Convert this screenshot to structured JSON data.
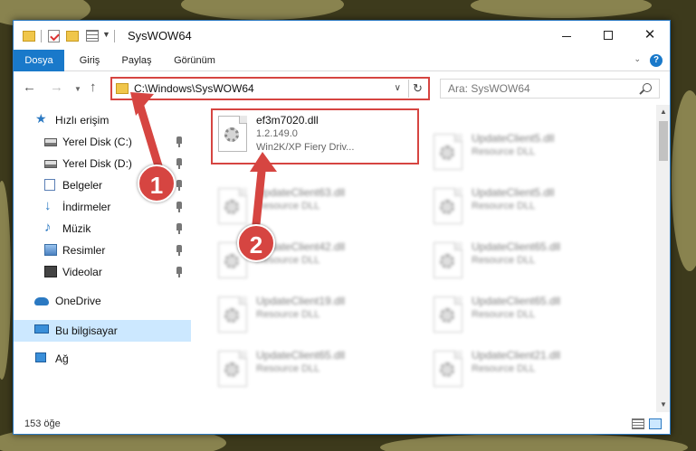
{
  "window": {
    "title": "SysWOW64"
  },
  "ribbon": {
    "tabs": [
      "Dosya",
      "Giriş",
      "Paylaş",
      "Görünüm"
    ]
  },
  "address": {
    "path": "C:\\Windows\\SysWOW64",
    "search_placeholder": "Ara: SysWOW64"
  },
  "nav": {
    "items": [
      {
        "label": "Hızlı erişim",
        "icon": "star-icon",
        "pinned": false
      },
      {
        "label": "Yerel Disk (C:)",
        "icon": "drive-icon",
        "pinned": true
      },
      {
        "label": "Yerel Disk (D:)",
        "icon": "drive-icon",
        "pinned": true
      },
      {
        "label": "Belgeler",
        "icon": "document-icon",
        "pinned": true
      },
      {
        "label": "İndirmeler",
        "icon": "download-icon",
        "pinned": true
      },
      {
        "label": "Müzik",
        "icon": "music-icon",
        "pinned": true
      },
      {
        "label": "Resimler",
        "icon": "pictures-icon",
        "pinned": true
      },
      {
        "label": "Videolar",
        "icon": "videos-icon",
        "pinned": true
      },
      {
        "label": "OneDrive",
        "icon": "cloud-icon",
        "pinned": false
      },
      {
        "label": "Bu bilgisayar",
        "icon": "computer-icon",
        "pinned": false,
        "selected": true
      },
      {
        "label": "Ağ",
        "icon": "network-icon",
        "pinned": false
      }
    ]
  },
  "files": {
    "main": {
      "name": "ef3m7020.dll",
      "version": "1.2.149.0",
      "description": "Win2K/XP Fiery Driv..."
    },
    "left_column": [
      {
        "name": "UpdateClient63.dll",
        "type": "Resource DLL"
      },
      {
        "name": "UpdateClient42.dll",
        "type": "Resource DLL"
      },
      {
        "name": "UpdateClient19.dll",
        "type": "Resource DLL"
      },
      {
        "name": "UpdateClient65.dll",
        "type": "Resource DLL"
      }
    ],
    "right_column": [
      {
        "name": "UpdateClient5.dll",
        "type": "Resource DLL"
      },
      {
        "name": "UpdateClient5.dll",
        "type": "Resource DLL"
      },
      {
        "name": "UpdateClient65.dll",
        "type": "Resource DLL"
      },
      {
        "name": "UpdateClient65.dll",
        "type": "Resource DLL"
      },
      {
        "name": "UpdateClient21.dll",
        "type": "Resource DLL"
      }
    ]
  },
  "status": {
    "count": "153 öğe"
  },
  "annotations": {
    "badge1": "1",
    "badge2": "2",
    "color": "#d64541"
  }
}
